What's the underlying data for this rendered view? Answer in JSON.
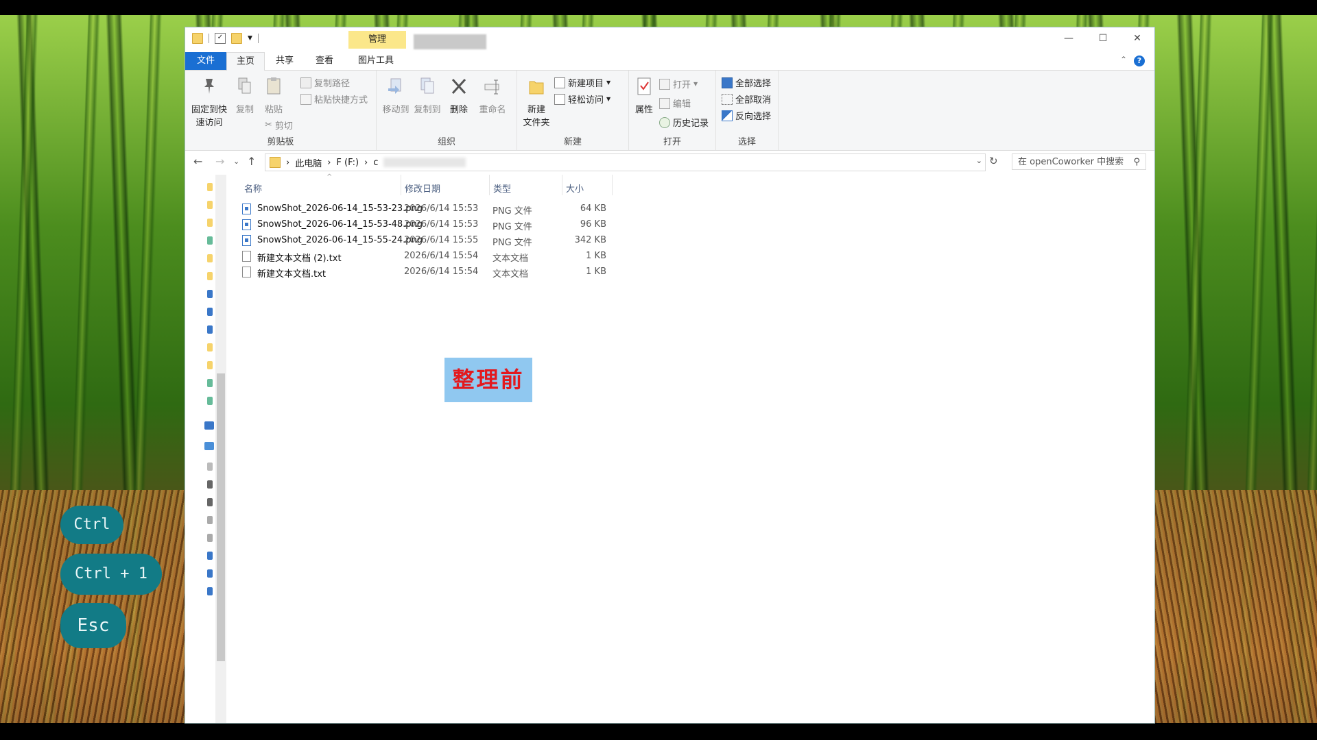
{
  "titlebar": {
    "manage_tab": "管理",
    "picture_tools_tab": "图片工具",
    "minimize": "—",
    "maximize": "☐",
    "close": "✕"
  },
  "tabs": {
    "file": "文件",
    "home": "主页",
    "share": "共享",
    "view": "查看",
    "picture_tools": "图片工具"
  },
  "ribbon": {
    "pin": "固定到快\n速访问",
    "pin_l1": "固定到快",
    "pin_l2": "速访问",
    "copy": "复制",
    "paste": "粘贴",
    "copy_path": "复制路径",
    "paste_shortcut": "粘贴快捷方式",
    "cut": "剪切",
    "clipboard": "剪贴板",
    "move_to": "移动到",
    "copy_to": "复制到",
    "delete": "删除",
    "rename": "重命名",
    "organize": "组织",
    "new_item": "新建项目",
    "easy_access": "轻松访问",
    "new_folder_l1": "新建",
    "new_folder_l2": "文件夹",
    "new": "新建",
    "properties": "属性",
    "open": "打开",
    "edit": "编辑",
    "history": "历史记录",
    "open_group": "打开",
    "select_all": "全部选择",
    "select_none": "全部取消",
    "invert_selection": "反向选择",
    "select_group": "选择"
  },
  "address": {
    "crumb_pc": "此电脑",
    "crumb_drive": "F (F:)",
    "crumb_folder": "c",
    "search_placeholder": "在 openCoworker 中搜索"
  },
  "columns": {
    "name": "名称",
    "date": "修改日期",
    "type": "类型",
    "size": "大小"
  },
  "files": [
    {
      "name": "SnowShot_2026-06-14_15-53-23.png",
      "date": "2026/6/14 15:53",
      "type": "PNG 文件",
      "size": "64 KB",
      "kind": "png"
    },
    {
      "name": "SnowShot_2026-06-14_15-53-48.png",
      "date": "2026/6/14 15:53",
      "type": "PNG 文件",
      "size": "96 KB",
      "kind": "png"
    },
    {
      "name": "SnowShot_2026-06-14_15-55-24.png",
      "date": "2026/6/14 15:55",
      "type": "PNG 文件",
      "size": "342 KB",
      "kind": "png"
    },
    {
      "name": "新建文本文档 (2).txt",
      "date": "2026/6/14 15:54",
      "type": "文本文档",
      "size": "1 KB",
      "kind": "txt"
    },
    {
      "name": "新建文本文档.txt",
      "date": "2026/6/14 15:54",
      "type": "文本文档",
      "size": "1 KB",
      "kind": "txt"
    }
  ],
  "overlay_label": "整理前",
  "keycaps": {
    "ctrl": "Ctrl",
    "ctrl1": "Ctrl + 1",
    "esc": "Esc"
  },
  "colors": {
    "accent": "#1a6fd3",
    "manage_tab": "#fbe78a",
    "keycap": "#127b86",
    "label_bg": "#90c8f0",
    "label_text": "#e3191e"
  }
}
